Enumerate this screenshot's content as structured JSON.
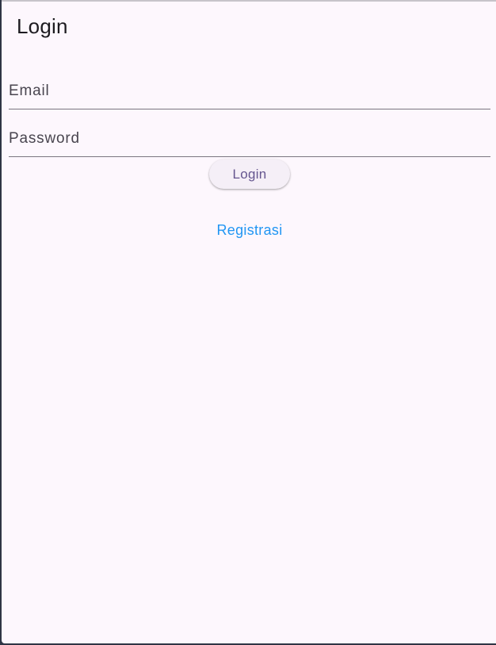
{
  "app_bar": {
    "title": "Login"
  },
  "form": {
    "email": {
      "label": "Email",
      "value": ""
    },
    "password": {
      "label": "Password",
      "value": ""
    },
    "login_label": "Login",
    "register_label": "Registrasi"
  },
  "colors": {
    "background": "#fdf7fd",
    "button_text": "#65558f",
    "button_background": "#f5eff7",
    "link": "#2196f3"
  }
}
